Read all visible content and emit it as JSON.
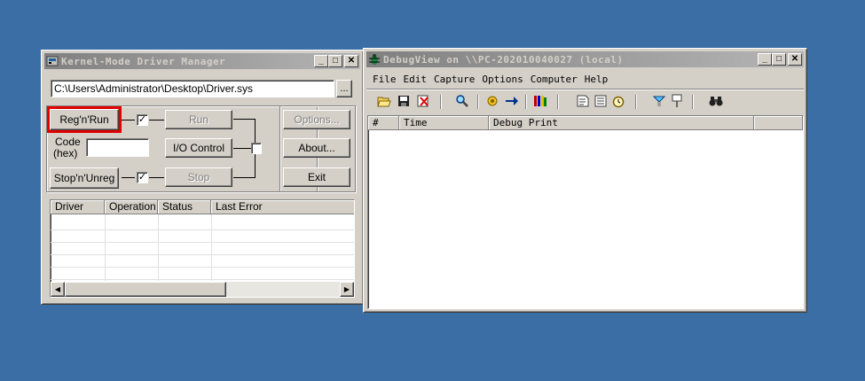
{
  "kmd": {
    "title": "Kernel-Mode Driver Manager",
    "path_value": "C:\\Users\\Administrator\\Desktop\\Driver.sys",
    "browse_label": "...",
    "reg_run_label": "Reg'n'Run",
    "run_label": "Run",
    "code_label_1": "Code",
    "code_label_2": "(hex)",
    "ioctl_label": "I/O Control",
    "stop_unreg_label": "Stop'n'Unreg",
    "stop_label": "Stop",
    "options_label": "Options...",
    "about_label": "About...",
    "exit_label": "Exit",
    "columns": [
      "Driver",
      "Operation",
      "Status",
      "Last Error"
    ],
    "highlight_color": "#e00000"
  },
  "dbg": {
    "title": "DebugView on \\\\PC-202010040027 (local)",
    "menu": [
      "File",
      "Edit",
      "Capture",
      "Options",
      "Computer",
      "Help"
    ],
    "toolbar_icons": [
      "open-icon",
      "save-icon",
      "clear-icon",
      "find-icon",
      "capture-icon",
      "autoscroll-icon",
      "filter-icon",
      "clock-icon",
      "time-icon",
      "history-icon",
      "highlight-icon",
      "pin-icon",
      "search-binoculars-icon"
    ],
    "columns": [
      "#",
      "Time",
      "Debug Print"
    ]
  },
  "window_buttons": {
    "minimize": "_",
    "maximize": "□",
    "close": "✕"
  }
}
